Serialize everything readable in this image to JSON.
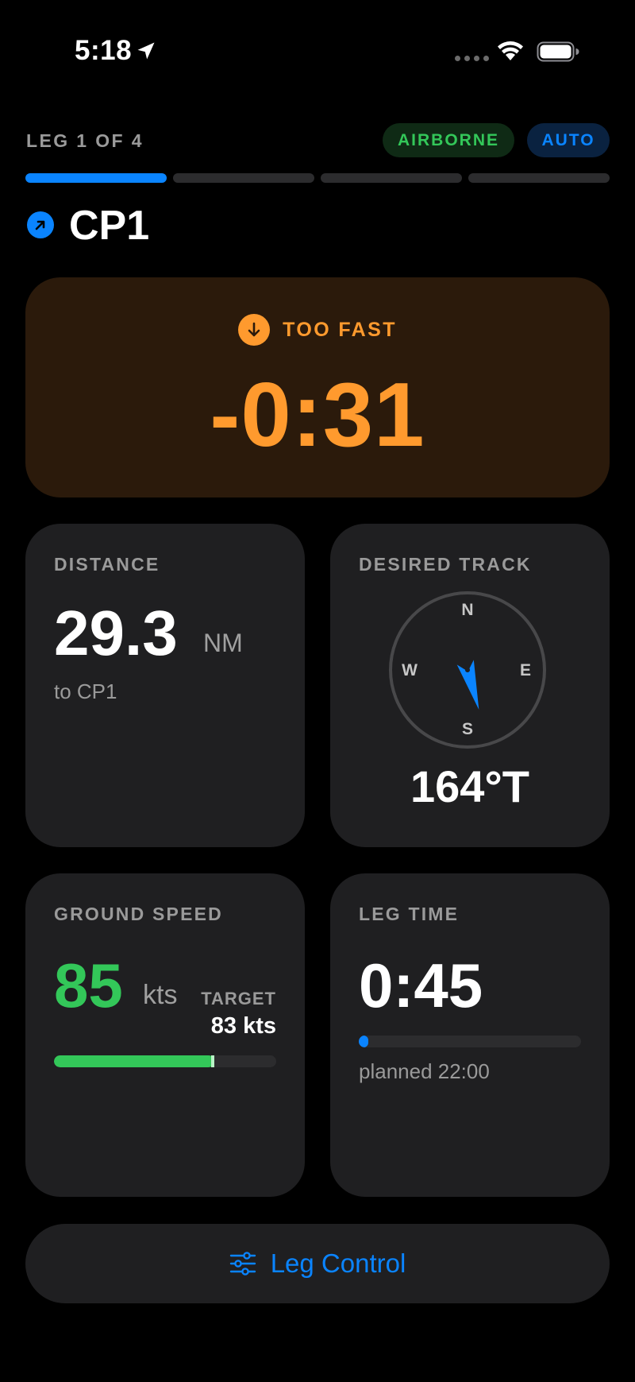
{
  "status_bar": {
    "time": "5:18",
    "icons": [
      "location-arrow-icon",
      "cellular-dots-icon",
      "wifi-icon",
      "battery-icon"
    ]
  },
  "leg": {
    "label": "LEG 1 OF 4",
    "current": 1,
    "total": 4,
    "badges": {
      "airborne": "AIRBORNE",
      "auto": "AUTO"
    },
    "waypoint": "CP1",
    "waypoint_icon": "arrow-up-right-icon"
  },
  "timing": {
    "status": "TOO FAST",
    "delta": "-0:31",
    "icon": "arrow-down-circle-icon"
  },
  "distance": {
    "title": "DISTANCE",
    "value": "29.3",
    "unit": "NM",
    "subtitle": "to CP1"
  },
  "track": {
    "title": "DESIRED TRACK",
    "value": "164°T",
    "heading_deg": 164,
    "compass": {
      "n": "N",
      "e": "E",
      "s": "S",
      "w": "W"
    }
  },
  "ground_speed": {
    "title": "GROUND SPEED",
    "value": "85",
    "unit": "kts",
    "target_label": "TARGET",
    "target_value": "83 kts",
    "bar_fraction": 0.72
  },
  "leg_time": {
    "title": "LEG TIME",
    "value": "0:45",
    "subtitle": "planned 22:00",
    "progress_fraction": 0.034
  },
  "leg_control": {
    "label": "Leg Control",
    "icon": "sliders-icon"
  },
  "colors": {
    "accent_blue": "#0a84ff",
    "green": "#33c759",
    "orange": "#ff9a2e",
    "card_bg": "#1f1f21"
  }
}
